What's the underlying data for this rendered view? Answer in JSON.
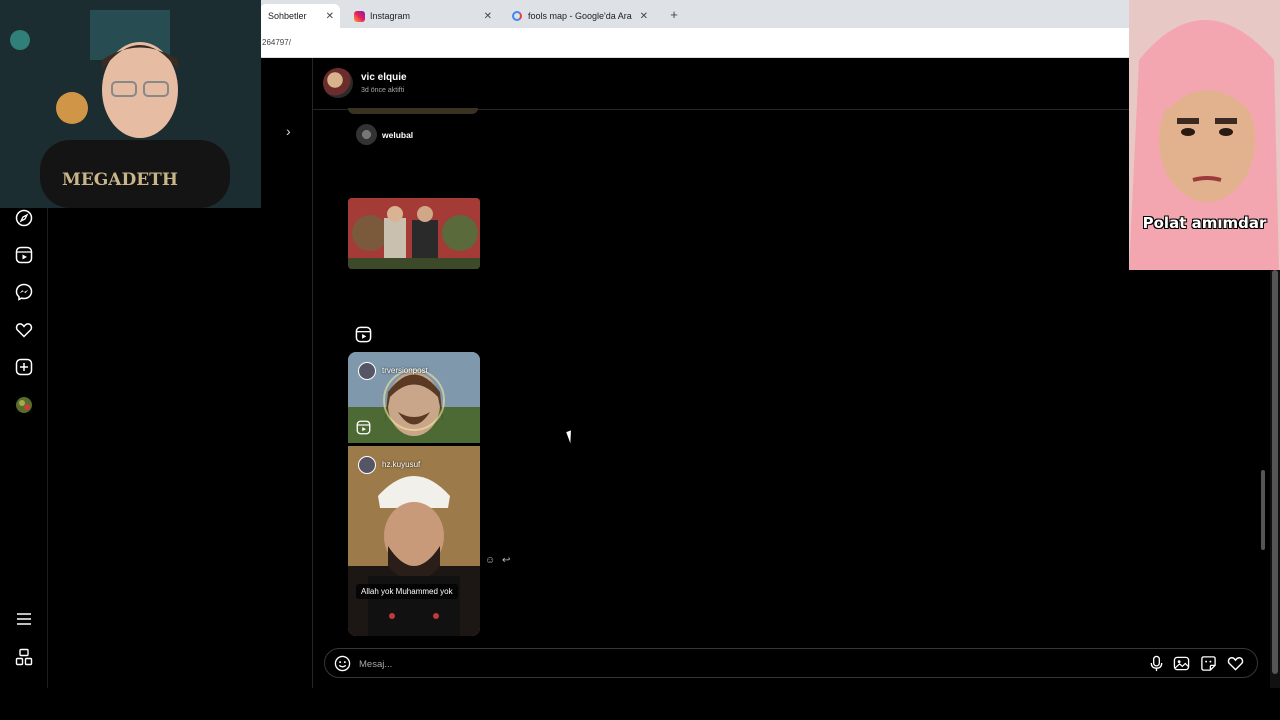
{
  "browser": {
    "tabs": [
      {
        "label": "Sohbetler",
        "active": true
      },
      {
        "label": "Instagram",
        "active": false
      },
      {
        "label": "fools map - Google'da Ara",
        "active": false
      }
    ],
    "url": "264797/"
  },
  "overlay": {
    "right_caption": "Polat amımdar",
    "left_shirt_text": "MEGADETH"
  },
  "chat": {
    "name": "vic elquie",
    "status": "3d önce aktifti"
  },
  "messages": {
    "sender_name": "welubal",
    "reel1_user": "trversionpost",
    "reel2_user": "hz.kuyusuf",
    "reel2_caption": "Allah yok Muhammed yok"
  },
  "composer": {
    "placeholder": "Mesaj..."
  },
  "icons": {
    "left_rail": [
      "explore-icon",
      "reels-icon",
      "messenger-icon",
      "heart-icon",
      "create-icon",
      "profile-avatar",
      "menu-icon",
      "threads-icon"
    ],
    "composer": [
      "emoji-icon",
      "microphone-icon",
      "image-icon",
      "sticker-icon",
      "heart-icon"
    ]
  }
}
